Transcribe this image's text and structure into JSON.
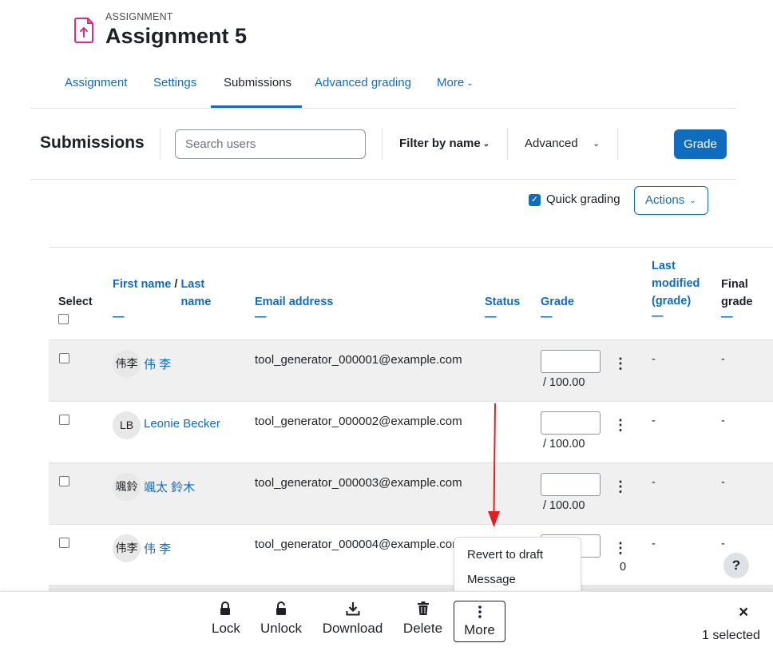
{
  "header": {
    "kicker": "ASSIGNMENT",
    "title": "Assignment 5"
  },
  "nav": {
    "tabs": [
      {
        "label": "Assignment"
      },
      {
        "label": "Settings"
      },
      {
        "label": "Submissions"
      },
      {
        "label": "Advanced grading"
      },
      {
        "label": "More"
      }
    ],
    "active": "Submissions"
  },
  "toolbar": {
    "heading": "Submissions",
    "search_placeholder": "Search users",
    "filter_label": "Filter by name",
    "advanced_label": "Advanced",
    "grade_label": "Grade"
  },
  "options": {
    "quick_grading_label": "Quick grading",
    "quick_grading_checked": true,
    "actions_label": "Actions"
  },
  "table": {
    "headers": {
      "select": "Select",
      "first_name": "First name",
      "slash": "/",
      "last_name": "Last name",
      "email": "Email address",
      "status": "Status",
      "grade": "Grade",
      "last_modified": "Last modified (grade)",
      "final_grade": "Final grade",
      "sort_dash": "—"
    },
    "rows": [
      {
        "initials": "伟李",
        "name": "伟 李",
        "email": "tool_generator_000001@example.com",
        "grade_max": "/ 100.00",
        "last_modified": "-",
        "final_grade": "-"
      },
      {
        "initials": "LB",
        "name": "Leonie Becker",
        "email": "tool_generator_000002@example.com",
        "grade_max": "/ 100.00",
        "last_modified": "-",
        "final_grade": "-"
      },
      {
        "initials": "颯鈴",
        "name": "颯太 鈴木",
        "email": "tool_generator_000003@example.com",
        "grade_max": "/ 100.00",
        "last_modified": "-",
        "final_grade": "-"
      },
      {
        "initials": "伟李",
        "name": "伟 李",
        "email": "tool_generator_000004@example.com",
        "grade_max": "0",
        "last_modified": "-",
        "final_grade": "-"
      }
    ]
  },
  "dropdown": {
    "items": [
      "Revert to draft",
      "Message"
    ]
  },
  "footer": {
    "buttons": [
      {
        "label": "Lock",
        "icon": "lock-icon"
      },
      {
        "label": "Unlock",
        "icon": "unlock-icon"
      },
      {
        "label": "Download",
        "icon": "download-icon"
      },
      {
        "label": "Delete",
        "icon": "trash-icon"
      },
      {
        "label": "More",
        "icon": "kebab-icon"
      }
    ],
    "selected_text": "1 selected",
    "close_symbol": "×"
  },
  "help": {
    "symbol": "?"
  },
  "colors": {
    "accent": "#0f6cbf",
    "activity_icon": "#e6287a",
    "arrow": "#e02020"
  }
}
